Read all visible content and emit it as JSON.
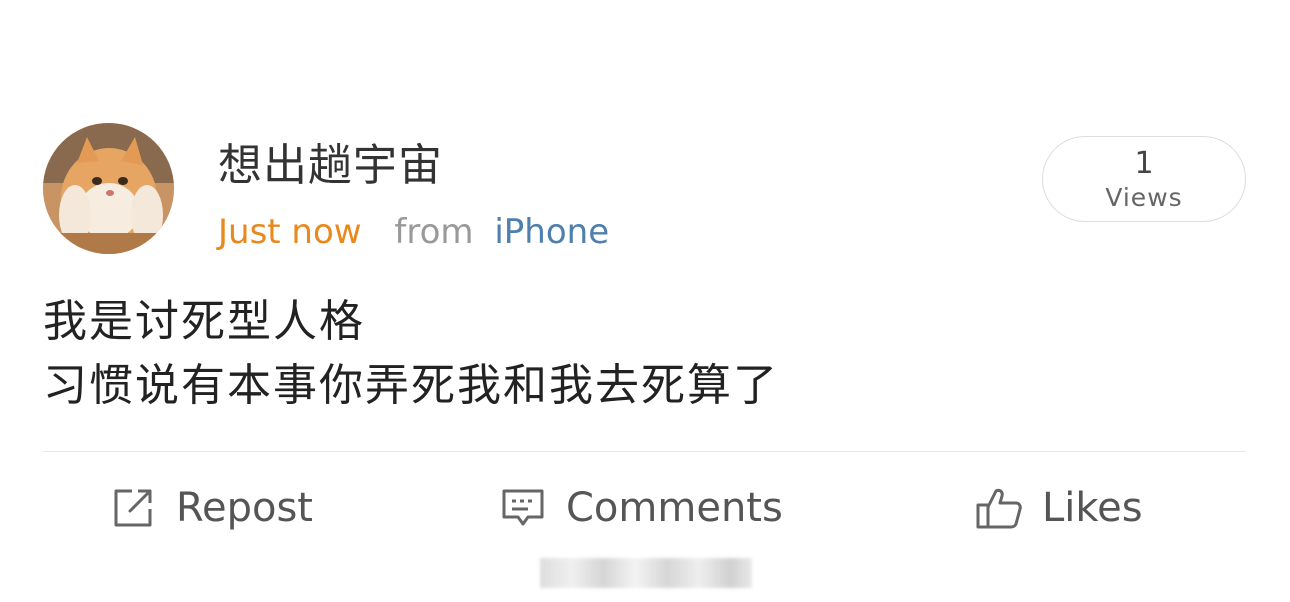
{
  "post": {
    "author": "想出趟宇宙",
    "time": "Just now",
    "source_prefix": "from",
    "source_device": "iPhone",
    "views": {
      "count": "1",
      "label": "Views"
    },
    "lines": [
      "我是讨死型人格",
      "习惯说有本事你弄死我和我去死算了"
    ]
  },
  "actions": {
    "repost": "Repost",
    "comments": "Comments",
    "likes": "Likes"
  },
  "icons": {
    "repost": "repost-icon",
    "comments": "comment-icon",
    "likes": "thumbs-up-icon"
  },
  "colors": {
    "time": "#e8891e",
    "device_link": "#4f7fad",
    "muted": "#999999"
  }
}
